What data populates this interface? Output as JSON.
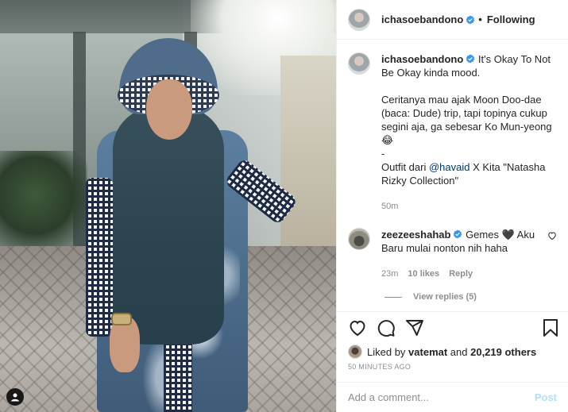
{
  "post": {
    "author": {
      "username": "ichasoebandono",
      "verified": true
    },
    "follow_status": "Following",
    "caption": {
      "line1": "It's Okay To Not Be Okay kinda mood.",
      "line2_pre": "Ceritanya mau ajak Moon Doo-dae (baca: Dude) trip, tapi topinya cukup segini aja, ga sebesar Ko Mun-yeong",
      "line2_emoji": "😂",
      "dash": "-",
      "line3_pre": "Outfit dari ",
      "line3_mention": "@havaid",
      "line3_post": " X Kita \"Natasha Rizky Collection\"",
      "time": "50m"
    },
    "comments": [
      {
        "username": "zeezeeshahab",
        "verified": true,
        "text_pre": "Gemes ",
        "heart": "🖤",
        "text_post": " Aku Baru mulai nonton nih haha",
        "time": "23m",
        "likes": "10 likes",
        "reply_label": "Reply",
        "view_replies": "View replies (5)"
      }
    ],
    "likes": {
      "prefix": "Liked by ",
      "liker": "vatemat",
      "middle": " and ",
      "others": "20,219 others"
    },
    "timestamp": "50 MINUTES AGO",
    "add_comment_placeholder": "Add a comment...",
    "post_button": "Post"
  },
  "colors": {
    "verified_blue": "#3897f0",
    "text": "#262626",
    "muted": "#8e8e8e",
    "link": "#00376b",
    "post_disabled": "#b2dffc"
  },
  "icons": [
    "verified-badge-icon",
    "heart-icon",
    "comment-icon",
    "share-icon",
    "bookmark-icon",
    "small-heart-icon",
    "user-tag-icon"
  ]
}
